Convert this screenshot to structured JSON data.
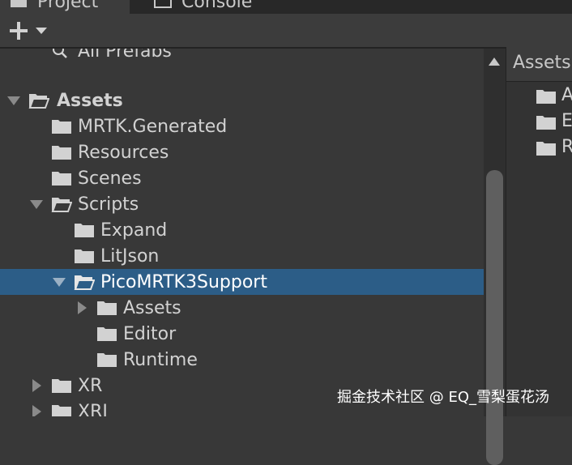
{
  "tabs": [
    {
      "label": "Project",
      "icon": "folder-tab-icon"
    },
    {
      "label": "Console",
      "icon": "console-icon"
    }
  ],
  "toolbar": {
    "add_icon": "plus-icon",
    "dropdown_icon": "chevron-down-icon"
  },
  "tree": {
    "items": [
      {
        "label": "All Prefabs",
        "icon": "search-icon"
      },
      {
        "label": "Assets",
        "icon": "open-folder-icon",
        "expanded": true,
        "bold": true
      },
      {
        "label": "MRTK.Generated",
        "icon": "folder-icon"
      },
      {
        "label": "Resources",
        "icon": "folder-icon"
      },
      {
        "label": "Scenes",
        "icon": "folder-icon"
      },
      {
        "label": "Scripts",
        "icon": "open-folder-icon",
        "expanded": true
      },
      {
        "label": "Expand",
        "icon": "folder-icon"
      },
      {
        "label": "LitJson",
        "icon": "folder-icon"
      },
      {
        "label": "PicoMRTK3Support",
        "icon": "open-folder-icon",
        "expanded": true,
        "selected": true
      },
      {
        "label": "Assets",
        "icon": "folder-icon",
        "collapsed": true
      },
      {
        "label": "Editor",
        "icon": "folder-icon"
      },
      {
        "label": "Runtime",
        "icon": "folder-icon"
      },
      {
        "label": "XR",
        "icon": "folder-icon",
        "collapsed": true
      },
      {
        "label": "XRI",
        "icon": "folder-icon",
        "collapsed": true
      }
    ]
  },
  "right_panel": {
    "header": "Assets",
    "items": [
      {
        "label": "A",
        "icon": "folder-icon"
      },
      {
        "label": "E",
        "icon": "folder-icon"
      },
      {
        "label": "R",
        "icon": "folder-icon"
      }
    ]
  },
  "watermark": "掘金技术社区 @ EQ_雪梨蛋花汤",
  "colors": {
    "selection": "#2c5d87",
    "panel": "#383838",
    "text": "#d2d2d2"
  }
}
